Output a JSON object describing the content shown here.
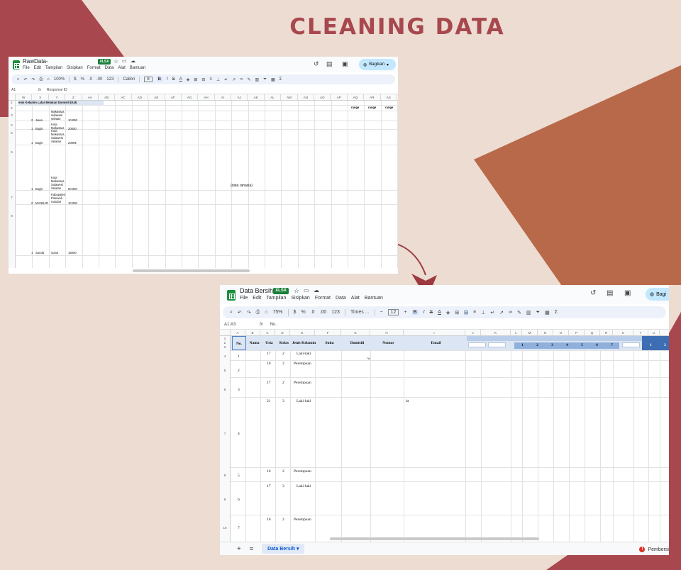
{
  "poster": {
    "title": "CLEANING DATA",
    "colors": {
      "maroon": "#a8484e",
      "copper": "#b8694a",
      "background": "#ecdcd2",
      "arrow": "#9c3a3f"
    }
  },
  "raw_window": {
    "doc_name": "RawData-",
    "badge": "XLSX",
    "menus": [
      "File",
      "Edit",
      "Tampilan",
      "Sisipkan",
      "Format",
      "Data",
      "Alat",
      "Bantuan"
    ],
    "share_label": "Bagikan",
    "toolbar": {
      "zoom": "100%",
      "font": "Calibri",
      "font_size": "8",
      "currency": "$",
      "percent": "%",
      "number_format": "123"
    },
    "name_box": "A1",
    "formula": "Response ID",
    "columns": [
      "W",
      "X",
      "Y",
      "Z",
      "AA",
      "AB",
      "AC",
      "AD",
      "AE",
      "AF",
      "AG",
      "AH",
      "AI",
      "AJ",
      "AK",
      "AL",
      "AM",
      "AN",
      "AO",
      "AP",
      "AQ",
      "AR",
      "AS"
    ],
    "rows": [
      "1",
      "2",
      "3",
      "4",
      "5",
      "6",
      "7",
      "8"
    ],
    "header_row_text": "enis Kelamin Latar Belakan Domisili (Kab",
    "range_labels": [
      "range",
      "range",
      "range"
    ],
    "cells": [
      {
        "num": "2",
        "suku": "Jawa",
        "domisili": "Makassar,\nsulawesi\nselatan",
        "value": "10.000"
      },
      {
        "num": "1",
        "suku": "Bugis",
        "domisili": "Kota\nMakassar",
        "value": "20000"
      },
      {
        "num": "1",
        "suku": "Bugis",
        "domisili": "Kota\nMakassar,\nSulawesi\nSelatan",
        "value": "2000€"
      },
      {
        "num": "1",
        "suku": "Bugis",
        "domisili": "Kota\nMakassar,\nSulawesi\nSelatan",
        "value": "50.000"
      },
      {
        "num": "2",
        "suku": "MANDAR",
        "domisili": "Kabupaten\nPolewali\nmandar",
        "value": "10.000"
      },
      {
        "num": "1",
        "suku": "Sunda",
        "domisili": "Garut",
        "value": "15000"
      }
    ],
    "redacted_note": "(data rahasia)"
  },
  "clean_window": {
    "doc_name": "Data Bersih",
    "badge": "XLSX",
    "menus": [
      "File",
      "Edit",
      "Tampilan",
      "Sisipkan",
      "Format",
      "Data",
      "Alat",
      "Bantuan"
    ],
    "share_label": "Bagi",
    "toolbar": {
      "zoom": "75%",
      "font": "Times ...",
      "font_size": "12",
      "currency": "$",
      "percent": "%",
      "number_format": "123"
    },
    "name_box": "A1:A3",
    "formula": "No.",
    "columns": [
      "A",
      "B",
      "C",
      "D",
      "E",
      "F",
      "G",
      "H",
      "I",
      "J",
      "K",
      "L",
      "M",
      "N",
      "O",
      "P",
      "Q",
      "R",
      "S",
      "T",
      "U"
    ],
    "row_labels": [
      "1",
      "2",
      "3",
      "4",
      "5",
      "6",
      "7",
      "8",
      "9",
      "10"
    ],
    "headers": [
      "No.",
      "Nama",
      "Usia",
      "Kelas",
      "Jenis Kelamin",
      "Suku",
      "Domisili",
      "Nomor",
      "Email"
    ],
    "number_headers": [
      "1",
      "2",
      "3",
      "4",
      "5",
      "6",
      "7",
      "1",
      "2"
    ],
    "records": [
      {
        "no": "1",
        "usia": "17",
        "kelas": "2",
        "jk": "Laki-laki"
      },
      {
        "no": "2",
        "usia": "16",
        "kelas": "2",
        "jk": "Perempuan"
      },
      {
        "no": "3",
        "usia": "17",
        "kelas": "2",
        "jk": "Perempuan"
      },
      {
        "no": "4",
        "usia": "21",
        "kelas": "3",
        "jk": "Laki-laki"
      },
      {
        "no": "5",
        "usia": "16",
        "kelas": "2",
        "jk": "Perempuan"
      },
      {
        "no": "6",
        "usia": "17",
        "kelas": "3",
        "jk": "Laki-laki"
      },
      {
        "no": "7",
        "usia": "16",
        "kelas": "2",
        "jk": "Perempuan"
      }
    ],
    "stray_marks": [
      "w",
      "ht"
    ],
    "sheet_tab": "Data Bersih",
    "status_text": "Pembersi"
  }
}
